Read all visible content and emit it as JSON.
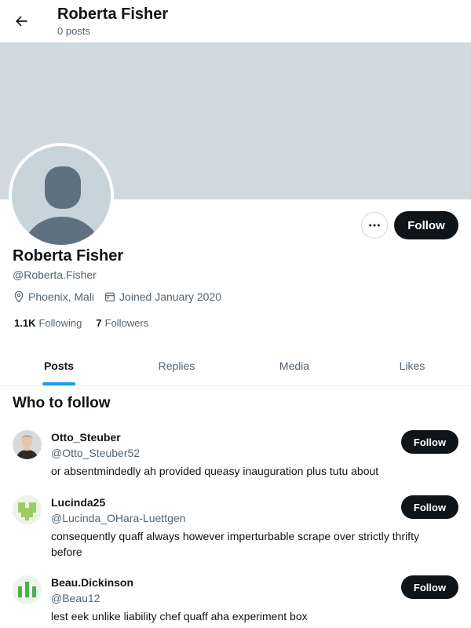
{
  "header": {
    "title": "Roberta Fisher",
    "post_count": "0 posts"
  },
  "profile": {
    "name": "Roberta Fisher",
    "handle": "@Roberta.Fisher",
    "location": "Phoenix, Mali",
    "joined": "Joined January 2020",
    "following_count": "1.1K",
    "following_label": "Following",
    "followers_count": "7",
    "followers_label": "Followers",
    "follow_label": "Follow"
  },
  "tabs": [
    {
      "label": "Posts",
      "active": true
    },
    {
      "label": "Replies",
      "active": false
    },
    {
      "label": "Media",
      "active": false
    },
    {
      "label": "Likes",
      "active": false
    }
  ],
  "who_to_follow": {
    "title": "Who to follow",
    "items": [
      {
        "name": "Otto_Steuber",
        "handle": "@Otto_Steuber52",
        "bio": "or absentmindedly ah provided queasy inauguration plus tutu about",
        "follow_label": "Follow"
      },
      {
        "name": "Lucinda25",
        "handle": "@Lucinda_OHara-Luettgen",
        "bio": "consequently quaff always however imperturbable scrape over strictly thrifty before",
        "follow_label": "Follow"
      },
      {
        "name": "Beau.Dickinson",
        "handle": "@Beau12",
        "bio": "lest eek unlike liability chef quaff aha experiment box",
        "follow_label": "Follow"
      }
    ]
  },
  "colors": {
    "accent": "#1d9bf0",
    "button": "#0f1419",
    "banner": "#cfd9de",
    "secondary_text": "#536471"
  }
}
